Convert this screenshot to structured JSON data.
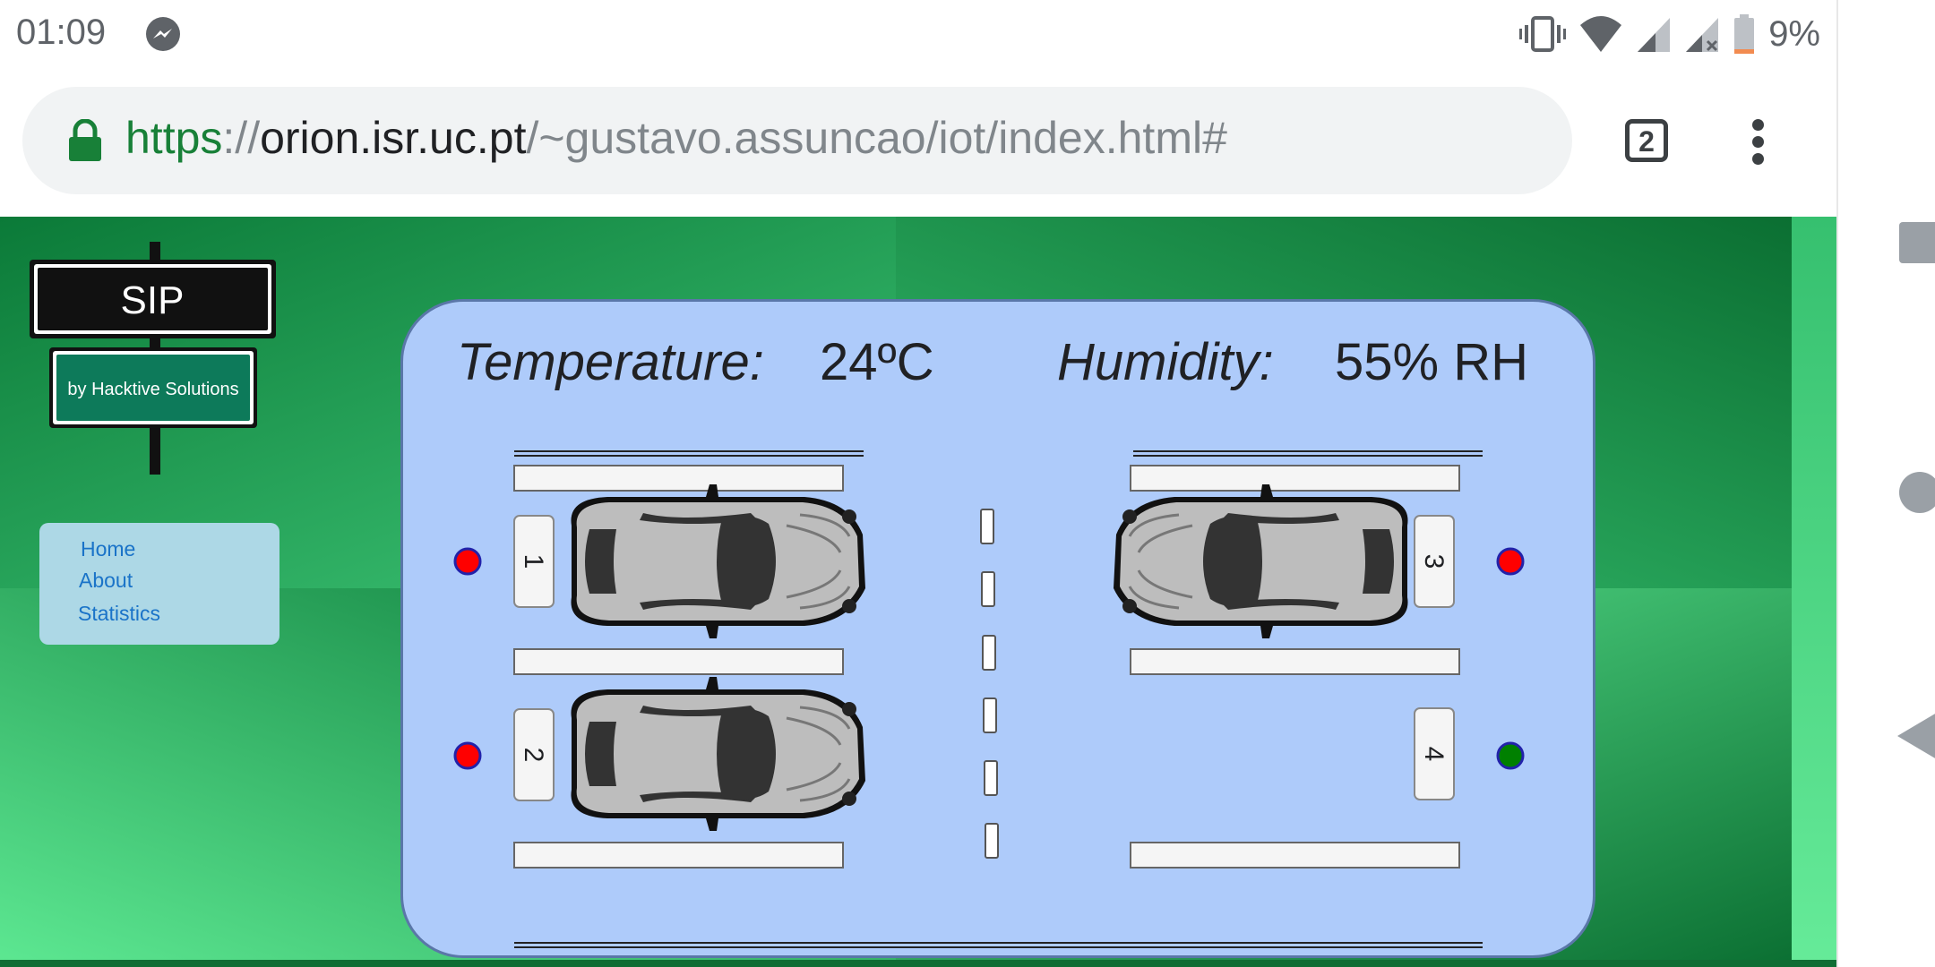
{
  "status_bar": {
    "time": "01:09",
    "battery_percent": "9%",
    "icons": [
      "messenger-icon",
      "vibrate-icon",
      "wifi-icon",
      "signal-icon",
      "signal-no-sim-icon",
      "battery-low-icon"
    ]
  },
  "browser": {
    "url_scheme": "https",
    "url_sep": "://",
    "url_host": "orion.isr.uc.pt",
    "url_path": "/~gustavo.assuncao/iot/index.html#",
    "tab_count": "2",
    "icons": [
      "lock-icon",
      "overflow-menu-icon"
    ]
  },
  "sidebar": {
    "logo_title": "SIP",
    "logo_subtitle": "by Hacktive Solutions",
    "menu": [
      {
        "label": "Home"
      },
      {
        "label": "About"
      },
      {
        "label": "Statistics"
      }
    ]
  },
  "dashboard": {
    "temperature_label": "Temperature:",
    "temperature_value": "24ºC",
    "humidity_label": "Humidity:",
    "humidity_value": "55% RH",
    "colors": {
      "occupied": "#ff0000",
      "free": "#008000",
      "panel": "#aecbfa"
    },
    "spots": [
      {
        "number": "1",
        "occupied": true
      },
      {
        "number": "2",
        "occupied": true
      },
      {
        "number": "3",
        "occupied": true
      },
      {
        "number": "4",
        "occupied": false
      }
    ]
  },
  "android_nav": {
    "icons": [
      "recents-icon",
      "home-icon",
      "back-icon"
    ]
  }
}
